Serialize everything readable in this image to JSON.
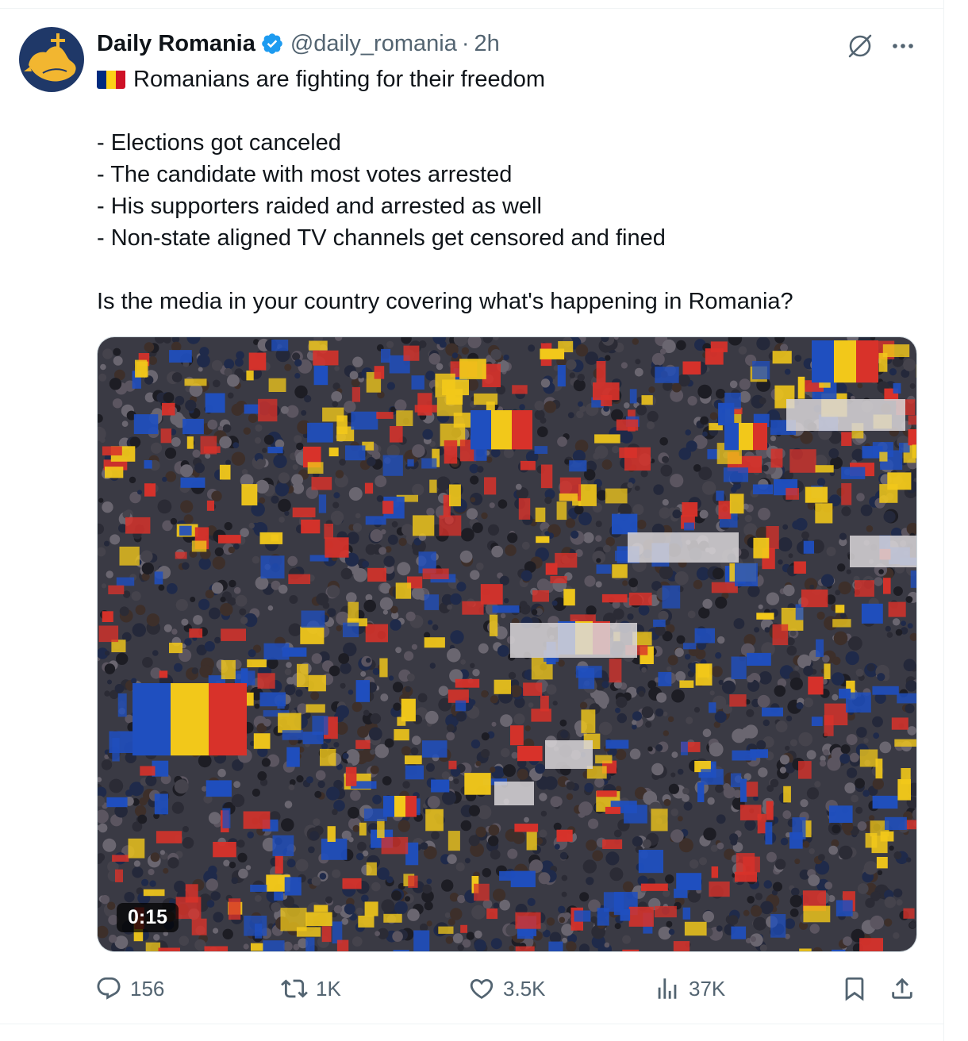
{
  "post": {
    "display_name": "Daily Romania",
    "handle": "@daily_romania",
    "separator": "·",
    "timestamp": "2h",
    "text_lines": [
      "Romanians are fighting for their freedom",
      "",
      "- Elections got canceled",
      "- The candidate with most votes arrested",
      "- His supporters raided and arrested as well",
      "- Non-state aligned TV channels get censored and fined",
      "",
      "Is the media in your country covering what's happening in Romania?"
    ],
    "flag_colors": [
      "#002b7f",
      "#fcd116",
      "#ce1126"
    ]
  },
  "media": {
    "duration": "0:15"
  },
  "actions": {
    "replies": "156",
    "reposts": "1K",
    "likes": "3.5K",
    "views": "37K"
  },
  "icons": {
    "verified": "verified-badge-icon",
    "grok": "grok-icon",
    "more": "more-icon",
    "reply": "reply-icon",
    "repost": "repost-icon",
    "like": "like-icon",
    "views": "views-icon",
    "bookmark": "bookmark-icon",
    "share": "share-icon"
  },
  "colors": {
    "accent": "#1d9bf0",
    "secondary_text": "#536471"
  }
}
